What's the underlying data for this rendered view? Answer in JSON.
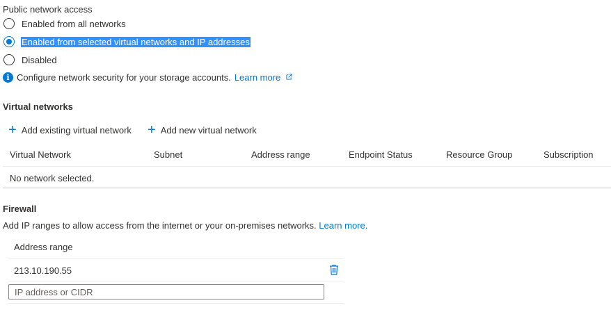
{
  "public_access": {
    "label": "Public network access",
    "options": [
      {
        "label": "Enabled from all networks",
        "checked": false
      },
      {
        "label": "Enabled from selected virtual networks and IP addresses",
        "checked": true
      },
      {
        "label": "Disabled",
        "checked": false
      }
    ],
    "info_text": "Configure network security for your storage accounts.",
    "info_link": "Learn more"
  },
  "virtual_networks": {
    "heading": "Virtual networks",
    "add_existing": "Add existing virtual network",
    "add_new": "Add new virtual network",
    "columns": [
      "Virtual Network",
      "Subnet",
      "Address range",
      "Endpoint Status",
      "Resource Group",
      "Subscription"
    ],
    "empty_text": "No network selected."
  },
  "firewall": {
    "heading": "Firewall",
    "description": "Add IP ranges to allow access from the internet or your on-premises networks.",
    "learn_more": "Learn more.",
    "column": "Address range",
    "rows": [
      "213.10.190.55"
    ],
    "input_placeholder": "IP address or CIDR"
  },
  "colors": {
    "accent": "#0078d4",
    "selection": "#3390ff"
  },
  "icons": [
    "info-icon",
    "external-link-icon",
    "add-icon",
    "delete-icon"
  ]
}
